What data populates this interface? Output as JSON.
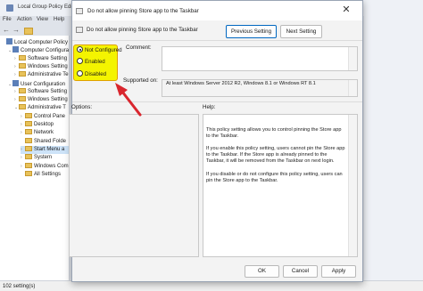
{
  "background_window": {
    "title": "Local Group Policy Edit",
    "menu": [
      "File",
      "Action",
      "View",
      "Help"
    ],
    "toolbar_icons": [
      "back-icon",
      "forward-icon",
      "folder-icon"
    ],
    "tree": [
      {
        "label": "Local Computer Policy",
        "indent": 0,
        "icon": "policy",
        "twisty": ""
      },
      {
        "label": "Computer Configura",
        "indent": 1,
        "icon": "computer",
        "twisty": "⌄"
      },
      {
        "label": "Software Setting",
        "indent": 2,
        "icon": "folder",
        "twisty": "›"
      },
      {
        "label": "Windows Setting",
        "indent": 2,
        "icon": "folder",
        "twisty": "›"
      },
      {
        "label": "Administrative Te",
        "indent": 2,
        "icon": "folder",
        "twisty": "›"
      },
      {
        "label": "User Configuration",
        "indent": 1,
        "icon": "computer",
        "twisty": "⌄"
      },
      {
        "label": "Software Setting",
        "indent": 2,
        "icon": "folder",
        "twisty": "›"
      },
      {
        "label": "Windows Setting",
        "indent": 2,
        "icon": "folder",
        "twisty": "›"
      },
      {
        "label": "Administrative T",
        "indent": 2,
        "icon": "folder",
        "twisty": "⌄"
      },
      {
        "label": "Control Pane",
        "indent": 3,
        "icon": "folder",
        "twisty": "›"
      },
      {
        "label": "Desktop",
        "indent": 3,
        "icon": "folder",
        "twisty": "›"
      },
      {
        "label": "Network",
        "indent": 3,
        "icon": "folder",
        "twisty": "›"
      },
      {
        "label": "Shared Folde",
        "indent": 3,
        "icon": "folder",
        "twisty": ""
      },
      {
        "label": "Start Menu a",
        "indent": 3,
        "icon": "folder",
        "twisty": "›",
        "selected": true
      },
      {
        "label": "System",
        "indent": 3,
        "icon": "folder",
        "twisty": "›"
      },
      {
        "label": "Windows Com",
        "indent": 3,
        "icon": "folder",
        "twisty": "›"
      },
      {
        "label": "All Settings",
        "indent": 3,
        "icon": "folder",
        "twisty": ""
      }
    ],
    "status": "102 setting(s)"
  },
  "dialog": {
    "title": "Do not allow pinning Store app to the Taskbar",
    "policy_name": "Do not allow pinning Store app to the Taskbar",
    "close_glyph": "✕",
    "previous_label": "Previous Setting",
    "next_label": "Next Setting",
    "states": [
      {
        "label": "Not Configured",
        "checked": true
      },
      {
        "label": "Enabled",
        "checked": false
      },
      {
        "label": "Disabled",
        "checked": false
      }
    ],
    "comment_label": "Comment:",
    "supported_label": "Supported on:",
    "supported_value": "At least Windows Server 2012 R2, Windows 8.1 or Windows RT 8.1",
    "options_label": "Options:",
    "help_label": "Help:",
    "help": [
      "This policy setting allows you to control pinning the Store app to the Taskbar.",
      "If you enable this policy setting, users cannot pin the Store app to the Taskbar. If the Store app is already pinned to the Taskbar, it will be removed from the Taskbar on next login.",
      "If you disable or do not configure this policy setting, users can pin the Store app to the Taskbar."
    ],
    "ok_label": "OK",
    "cancel_label": "Cancel",
    "apply_label": "Apply"
  },
  "colors": {
    "highlight": "#f4f400",
    "annotation_arrow": "#d9262e",
    "accent": "#0067c0"
  }
}
